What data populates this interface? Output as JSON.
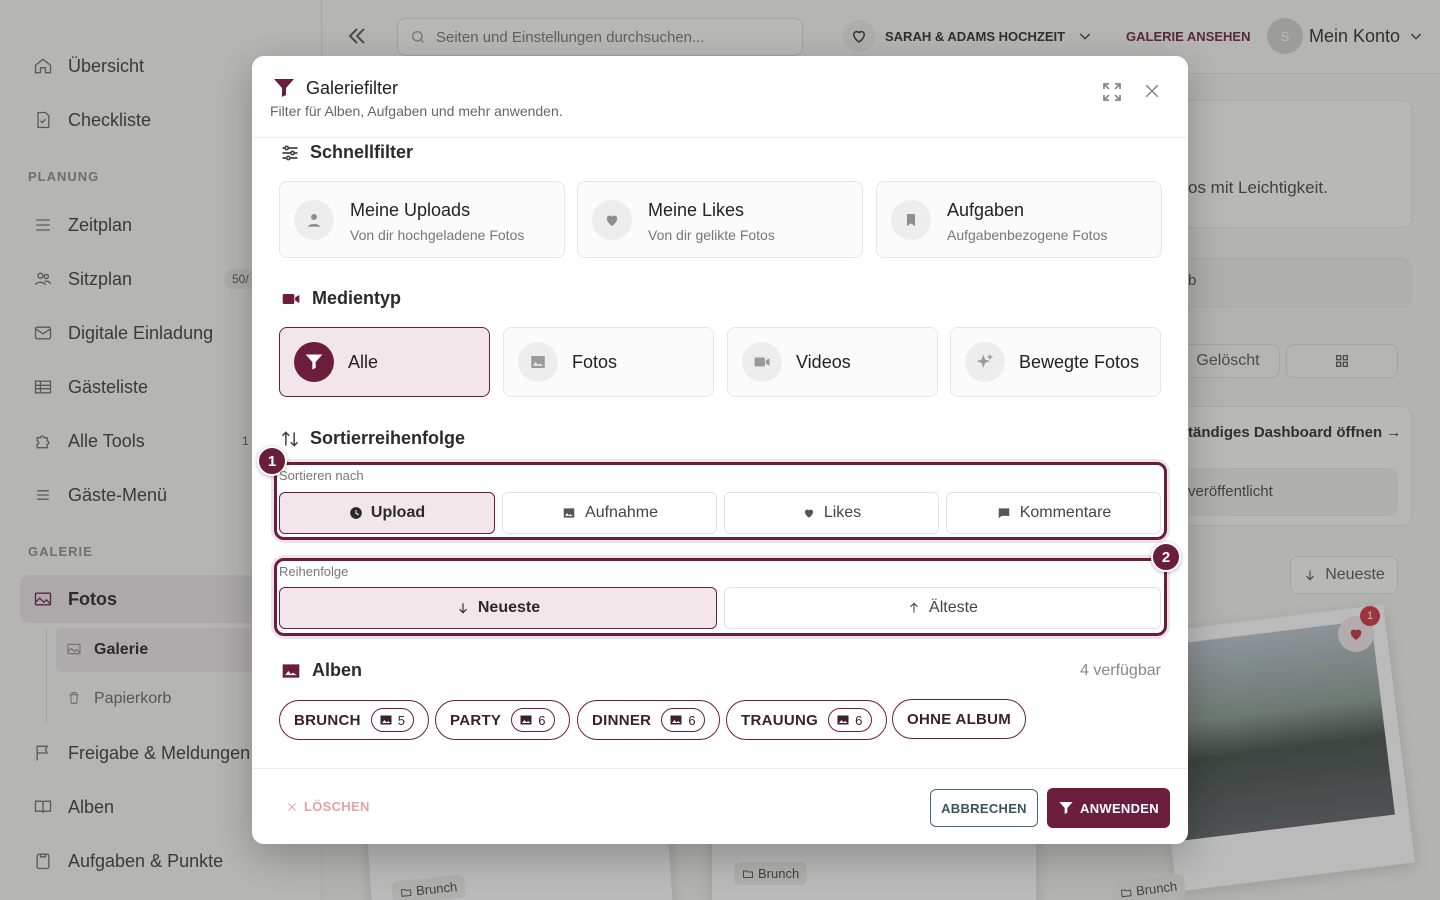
{
  "sidebar": {
    "items_top": [
      {
        "label": "Übersicht"
      },
      {
        "label": "Checkliste"
      }
    ],
    "section_planung": "PLANUNG",
    "planung_items": [
      {
        "label": "Zeitplan"
      },
      {
        "label": "Sitzplan",
        "count": "50/"
      },
      {
        "label": "Digitale Einladung"
      },
      {
        "label": "Gästeliste"
      },
      {
        "label": "Alle Tools",
        "count": "1"
      },
      {
        "label": "Gäste-Menü"
      }
    ],
    "section_galerie": "GALERIE",
    "galerie_item": "Fotos",
    "galerie_sub": [
      {
        "label": "Galerie"
      },
      {
        "label": "Papierkorb"
      }
    ],
    "bottom_items": [
      {
        "label": "Freigabe & Meldungen"
      },
      {
        "label": "Alben"
      },
      {
        "label": "Aufgaben & Punkte"
      }
    ]
  },
  "topbar": {
    "search_placeholder": "Seiten und Einstellungen durchsuchen...",
    "event_name": "SARAH & ADAMS HOCHZEIT",
    "gallery_link": "GALERIE ANSEHEN",
    "avatar_initial": "S",
    "account_label": "Mein Konto"
  },
  "background": {
    "tagline": "os mit Leichtigkeit.",
    "field_fragment": "b",
    "deleted_btn": "Gelöscht",
    "dashboard_link": "tändiges Dashboard öffnen →",
    "published": "veröffentlicht",
    "sort_btn": "Neueste",
    "like_badge": "1",
    "tags": [
      "Brunch",
      "Brunch",
      "Brunch"
    ]
  },
  "modal": {
    "title": "Galeriefilter",
    "subtitle": "Filter für Alben, Aufgaben und mehr anwenden.",
    "quick_title": "Schnellfilter",
    "quick_filters": [
      {
        "title": "Meine Uploads",
        "desc": "Von dir hochgeladene Fotos",
        "icon": "user-icon"
      },
      {
        "title": "Meine Likes",
        "desc": "Von dir gelikte Fotos",
        "icon": "heart-icon"
      },
      {
        "title": "Aufgaben",
        "desc": "Aufgabenbezogene Fotos",
        "icon": "bookmark-icon"
      }
    ],
    "media_title": "Medientyp",
    "media_types": [
      {
        "label": "Alle",
        "active": true
      },
      {
        "label": "Fotos",
        "active": false
      },
      {
        "label": "Videos",
        "active": false
      },
      {
        "label": "Bewegte Fotos",
        "active": false
      }
    ],
    "sort_title": "Sortierreihenfolge",
    "sort_by_label": "Sortieren nach",
    "sort_by": [
      {
        "label": "Upload",
        "active": true
      },
      {
        "label": "Aufnahme",
        "active": false
      },
      {
        "label": "Likes",
        "active": false
      },
      {
        "label": "Kommentare",
        "active": false
      }
    ],
    "order_label": "Reihenfolge",
    "order": [
      {
        "label": "Neueste",
        "active": true
      },
      {
        "label": "Älteste",
        "active": false
      }
    ],
    "highlight_badges": [
      "1",
      "2"
    ],
    "albums_title": "Alben",
    "albums_available": "4 verfügbar",
    "albums": [
      {
        "label": "BRUNCH",
        "count": "5"
      },
      {
        "label": "PARTY",
        "count": "6"
      },
      {
        "label": "DINNER",
        "count": "6"
      },
      {
        "label": "TRAUUNG",
        "count": "6"
      },
      {
        "label": "OHNE ALBUM",
        "count": ""
      }
    ],
    "footer": {
      "clear": "LÖSCHEN",
      "cancel": "ABBRECHEN",
      "apply": "ANWENDEN"
    }
  },
  "colors": {
    "accent": "#6b1d3c",
    "accent_light": "#f3e6ea",
    "cancel_border": "#3c6b7a"
  }
}
